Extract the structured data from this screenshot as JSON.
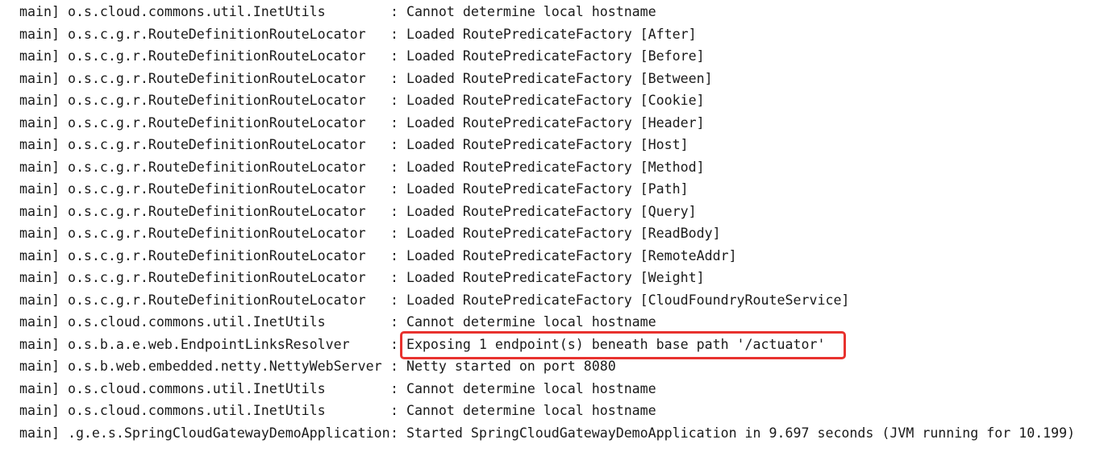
{
  "console": {
    "lines": [
      {
        "thread": "main]",
        "logger": "o.s.cloud.commons.util.InetUtils",
        "sep": ":",
        "message": "Cannot determine local hostname"
      },
      {
        "thread": "main]",
        "logger": "o.s.c.g.r.RouteDefinitionRouteLocator",
        "sep": ":",
        "message": "Loaded RoutePredicateFactory [After]"
      },
      {
        "thread": "main]",
        "logger": "o.s.c.g.r.RouteDefinitionRouteLocator",
        "sep": ":",
        "message": "Loaded RoutePredicateFactory [Before]"
      },
      {
        "thread": "main]",
        "logger": "o.s.c.g.r.RouteDefinitionRouteLocator",
        "sep": ":",
        "message": "Loaded RoutePredicateFactory [Between]"
      },
      {
        "thread": "main]",
        "logger": "o.s.c.g.r.RouteDefinitionRouteLocator",
        "sep": ":",
        "message": "Loaded RoutePredicateFactory [Cookie]"
      },
      {
        "thread": "main]",
        "logger": "o.s.c.g.r.RouteDefinitionRouteLocator",
        "sep": ":",
        "message": "Loaded RoutePredicateFactory [Header]"
      },
      {
        "thread": "main]",
        "logger": "o.s.c.g.r.RouteDefinitionRouteLocator",
        "sep": ":",
        "message": "Loaded RoutePredicateFactory [Host]"
      },
      {
        "thread": "main]",
        "logger": "o.s.c.g.r.RouteDefinitionRouteLocator",
        "sep": ":",
        "message": "Loaded RoutePredicateFactory [Method]"
      },
      {
        "thread": "main]",
        "logger": "o.s.c.g.r.RouteDefinitionRouteLocator",
        "sep": ":",
        "message": "Loaded RoutePredicateFactory [Path]"
      },
      {
        "thread": "main]",
        "logger": "o.s.c.g.r.RouteDefinitionRouteLocator",
        "sep": ":",
        "message": "Loaded RoutePredicateFactory [Query]"
      },
      {
        "thread": "main]",
        "logger": "o.s.c.g.r.RouteDefinitionRouteLocator",
        "sep": ":",
        "message": "Loaded RoutePredicateFactory [ReadBody]"
      },
      {
        "thread": "main]",
        "logger": "o.s.c.g.r.RouteDefinitionRouteLocator",
        "sep": ":",
        "message": "Loaded RoutePredicateFactory [RemoteAddr]"
      },
      {
        "thread": "main]",
        "logger": "o.s.c.g.r.RouteDefinitionRouteLocator",
        "sep": ":",
        "message": "Loaded RoutePredicateFactory [Weight]"
      },
      {
        "thread": "main]",
        "logger": "o.s.c.g.r.RouteDefinitionRouteLocator",
        "sep": ":",
        "message": "Loaded RoutePredicateFactory [CloudFoundryRouteService]"
      },
      {
        "thread": "main]",
        "logger": "o.s.cloud.commons.util.InetUtils",
        "sep": ":",
        "message": "Cannot determine local hostname"
      },
      {
        "thread": "main]",
        "logger": "o.s.b.a.e.web.EndpointLinksResolver",
        "sep": ":",
        "message": "Exposing 1 endpoint(s) beneath base path '/actuator'"
      },
      {
        "thread": "main]",
        "logger": "o.s.b.web.embedded.netty.NettyWebServer",
        "sep": ":",
        "message": "Netty started on port 8080"
      },
      {
        "thread": "main]",
        "logger": "o.s.cloud.commons.util.InetUtils",
        "sep": ":",
        "message": "Cannot determine local hostname"
      },
      {
        "thread": "main]",
        "logger": "o.s.cloud.commons.util.InetUtils",
        "sep": ":",
        "message": "Cannot determine local hostname"
      },
      {
        "thread": "main]",
        "logger": ".g.e.s.SpringCloudGatewayDemoApplication",
        "sep": ":",
        "message": "Started SpringCloudGatewayDemoApplication in 9.697 seconds (JVM running for 10.199)"
      }
    ]
  },
  "highlight": {
    "color": "#e8322e",
    "line_index": 15
  },
  "colors": {
    "background": "#ffffff",
    "text": "#1a1a1a"
  }
}
